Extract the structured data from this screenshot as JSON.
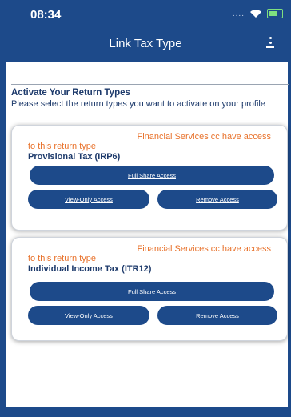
{
  "statusbar": {
    "time": "08:34",
    "signal_dots": "...."
  },
  "appbar": {
    "title": "Link Tax Type"
  },
  "section": {
    "title": "Activate Your Return Types",
    "description": "Please select the return types you want to activate on your profile"
  },
  "cards": [
    {
      "access_line1": "Financial Services cc have access",
      "access_line2": "to this return type",
      "type_name": "Provisional Tax (IRP6)",
      "full_share_label": "Full Share Access",
      "view_only_label": "View-Only Access",
      "remove_label": "Remove Access"
    },
    {
      "access_line1": "Financial Services cc have access",
      "access_line2": "to this return type",
      "type_name": "Individual Income Tax (ITR12)",
      "full_share_label": "Full Share Access",
      "view_only_label": "View-Only Access",
      "remove_label": "Remove Access"
    }
  ],
  "colors": {
    "primary": "#1d4a8a",
    "accent": "#e8712a",
    "text": "#1d3a6b"
  }
}
